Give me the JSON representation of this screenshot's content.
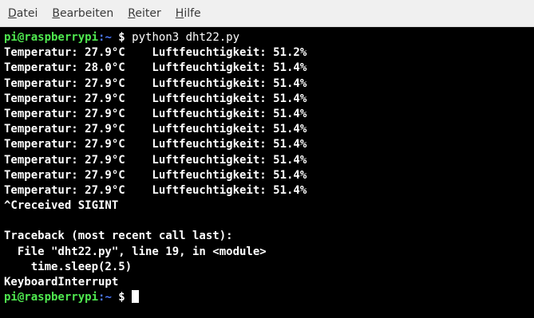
{
  "menubar": {
    "items": [
      {
        "mnemonic": "D",
        "rest": "atei"
      },
      {
        "mnemonic": "B",
        "rest": "earbeiten"
      },
      {
        "mnemonic": "R",
        "rest": "eiter"
      },
      {
        "mnemonic": "H",
        "rest": "ilfe"
      }
    ]
  },
  "terminal": {
    "prompt": {
      "user_host": "pi@raspberrypi",
      "path": ":~",
      "sign": " $ "
    },
    "command": "python3 dht22.py",
    "readings": [
      "Temperatur: 27.9°C    Luftfeuchtigkeit: 51.2%",
      "Temperatur: 28.0°C    Luftfeuchtigkeit: 51.4%",
      "Temperatur: 27.9°C    Luftfeuchtigkeit: 51.4%",
      "Temperatur: 27.9°C    Luftfeuchtigkeit: 51.4%",
      "Temperatur: 27.9°C    Luftfeuchtigkeit: 51.4%",
      "Temperatur: 27.9°C    Luftfeuchtigkeit: 51.4%",
      "Temperatur: 27.9°C    Luftfeuchtigkeit: 51.4%",
      "Temperatur: 27.9°C    Luftfeuchtigkeit: 51.4%",
      "Temperatur: 27.9°C    Luftfeuchtigkeit: 51.4%",
      "Temperatur: 27.9°C    Luftfeuchtigkeit: 51.4%"
    ],
    "interrupt": "^Creceived SIGINT",
    "blank": "",
    "traceback": [
      "Traceback (most recent call last):",
      "  File \"dht22.py\", line 19, in <module>",
      "    time.sleep(2.5)",
      "KeyboardInterrupt"
    ],
    "colors": {
      "background": "#000000",
      "text": "#ffffff",
      "prompt_user": "#4fe84f",
      "prompt_path": "#4d7bff"
    }
  }
}
